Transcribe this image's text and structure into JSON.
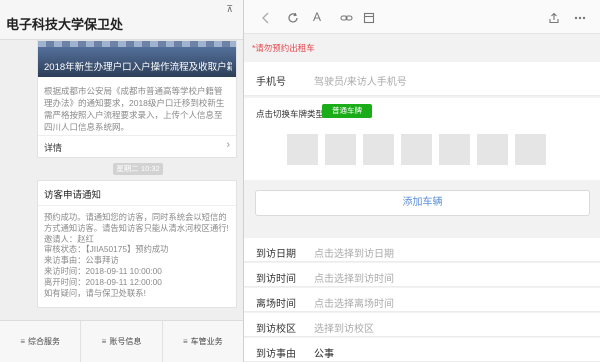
{
  "left": {
    "title": "电子科技大学保卫处",
    "pin_icon": "pin-icon",
    "news": {
      "banner_title": "2018年新生办理户口入户操作流程及收取户籍资料...",
      "summary": "根据成都市公安局《成都市普通高等学校户籍管理办法》的通知要求，2018级户口迁移到校新生需严格按照入户流程要求录入，上传个人信息至四川人口信息系统网。",
      "detail_label": "详情"
    },
    "timestamp": "星期二 10:32",
    "notice": {
      "heading": "访客申请通知",
      "body_lines": [
        "预约成功。请通知您的访客，同时系统会以短信的方式通知访客。请告知访客只能从清水河校区通行!",
        "邀请人：赵红",
        "审核状态：【JIIA50175】预约成功",
        "来访事由：公事拜访",
        "来访时间：2018-09-11 10:00:00",
        "离开时间：2018-09-11 12:00:00",
        "如有疑问，请与保卫处联系!"
      ]
    },
    "bottom_menu": [
      "综合服务",
      "账号信息",
      "车管业务"
    ]
  },
  "right": {
    "hint": "*请勿预约出租车",
    "phone": {
      "label": "手机号",
      "placeholder": "驾驶员/来访人手机号"
    },
    "plate": {
      "label": "点击切换车牌类型",
      "button": "普通车牌",
      "box_count": 7
    },
    "add_button": "添加车辆",
    "fields": [
      {
        "label": "到访日期",
        "value": "点击选择到访日期",
        "filled": false
      },
      {
        "label": "到访时间",
        "value": "点击选择到访时间",
        "filled": false
      },
      {
        "label": "离场时间",
        "value": "点击选择离场时间",
        "filled": false
      },
      {
        "label": "到访校区",
        "value": "选择到访校区",
        "filled": false
      },
      {
        "label": "到访事由",
        "value": "公事",
        "filled": true
      }
    ]
  },
  "colors": {
    "accent_green": "#1aad19",
    "hint_red": "#e5484d",
    "link_blue": "#5b8fd6"
  }
}
